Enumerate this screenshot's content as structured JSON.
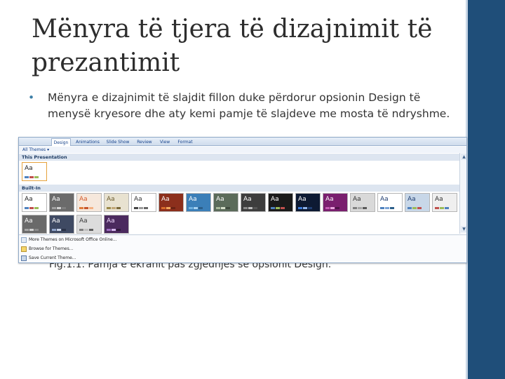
{
  "slide": {
    "title": "Mënyra të tjera të dizajnimit të prezantimit",
    "bullet": "Mënyra e dizajnimit të slajdit fillon duke përdorur opsionin Design të menysë kryesore dhe aty kemi pamje të slajdeve me mosta të ndryshme.",
    "caption": "Fig.1.1. Pamja e ekranit pas zgjedhjes së opsionit Design."
  },
  "ribbon": {
    "tabs": [
      "Design",
      "Animations",
      "Slide Show",
      "Review",
      "View",
      "Format"
    ]
  },
  "gallery": {
    "dropdown_label": "All Themes ▾",
    "this_presentation_label": "This Presentation",
    "built_in_label": "Built-In",
    "theme_glyph": "Aa",
    "themes": [
      {
        "bg": "#ffffff",
        "fg": "#222222",
        "a1": "#4f81bd",
        "a2": "#c0504d",
        "a3": "#9bbb59"
      },
      {
        "bg": "#6b6b6b",
        "fg": "#ffffff",
        "a1": "#a0a0a0",
        "a2": "#d0d0d0",
        "a3": "#808080"
      },
      {
        "bg": "#f6e8dc",
        "fg": "#d45a2a",
        "a1": "#e07b39",
        "a2": "#c5552b",
        "a3": "#f4b183"
      },
      {
        "bg": "#e8e2d0",
        "fg": "#6b5b2e",
        "a1": "#9c8a4b",
        "a2": "#c2a878",
        "a3": "#7a6a3a"
      },
      {
        "bg": "#ffffff",
        "fg": "#333333",
        "a1": "#444444",
        "a2": "#999999",
        "a3": "#666666"
      },
      {
        "bg": "#8c2f1c",
        "fg": "#ffffff",
        "a1": "#d86b2a",
        "a2": "#f2a65a",
        "a3": "#6a2314"
      },
      {
        "bg": "#3b7fb8",
        "fg": "#ffffff",
        "a1": "#6fb1e0",
        "a2": "#a6d1f0",
        "a3": "#2c5f8a"
      },
      {
        "bg": "#5b6b5a",
        "fg": "#ffffff",
        "a1": "#a8b89a",
        "a2": "#d4ddc8",
        "a3": "#3e4a3d"
      },
      {
        "bg": "#3d3d3d",
        "fg": "#ffffff",
        "a1": "#888888",
        "a2": "#bbbbbb",
        "a3": "#555555"
      },
      {
        "bg": "#1a1a1a",
        "fg": "#ffffff",
        "a1": "#4f81bd",
        "a2": "#9bbb59",
        "a3": "#c0504d"
      },
      {
        "bg": "#0d1a33",
        "fg": "#ffffff",
        "a1": "#3d7bd9",
        "a2": "#8fb4ec",
        "a3": "#1f3d70"
      },
      {
        "bg": "#7a1f6e",
        "fg": "#ffffff",
        "a1": "#c45ab3",
        "a2": "#e8a3dc",
        "a3": "#4d1346"
      },
      {
        "bg": "#d9d9d9",
        "fg": "#333333",
        "a1": "#7f7f7f",
        "a2": "#a5a5a5",
        "a3": "#595959"
      },
      {
        "bg": "#ffffff",
        "fg": "#1f3d70",
        "a1": "#4f81bd",
        "a2": "#7ba3d6",
        "a3": "#2c5f8a"
      },
      {
        "bg": "#c8d7e8",
        "fg": "#1f3d70",
        "a1": "#4f81bd",
        "a2": "#9bbb59",
        "a3": "#c0504d"
      },
      {
        "bg": "#efefef",
        "fg": "#333333",
        "a1": "#c0504d",
        "a2": "#9bbb59",
        "a3": "#4f81bd"
      },
      {
        "bg": "#6a6a6a",
        "fg": "#ffffff",
        "a1": "#a5a5a5",
        "a2": "#d0d0d0",
        "a3": "#8a8a8a"
      },
      {
        "bg": "#3f4a63",
        "fg": "#ffffff",
        "a1": "#8fa3c8",
        "a2": "#c8d3e8",
        "a3": "#2a3246"
      },
      {
        "bg": "#dcdcdc",
        "fg": "#3a3a3a",
        "a1": "#7f7f7f",
        "a2": "#bfbfbf",
        "a3": "#5f5f5f"
      },
      {
        "bg": "#4b2a5e",
        "fg": "#f0d9ff",
        "a1": "#9b6bbf",
        "a2": "#d3b4ea",
        "a3": "#2f1a3b"
      }
    ]
  },
  "menu": {
    "items": [
      "More Themes on Microsoft Office Online...",
      "Browse for Themes...",
      "Save Current Theme..."
    ]
  },
  "colors": {
    "accent_bar": "#1f4e79",
    "bullet": "#3c7ea6"
  }
}
